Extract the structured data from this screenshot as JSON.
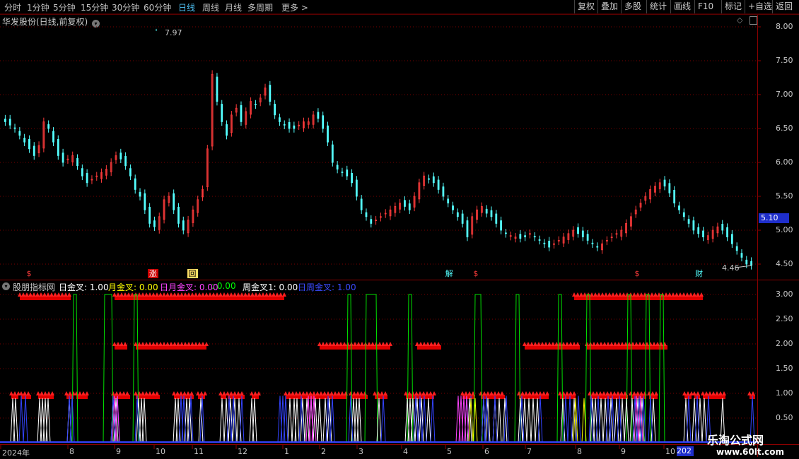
{
  "toolbar": {
    "periods": [
      {
        "label": "分时",
        "active": false
      },
      {
        "label": "1分钟",
        "active": false
      },
      {
        "label": "5分钟",
        "active": false
      },
      {
        "label": "15分钟",
        "active": false
      },
      {
        "label": "30分钟",
        "active": false
      },
      {
        "label": "60分钟",
        "active": false
      },
      {
        "label": "日线",
        "active": true
      },
      {
        "label": "周线",
        "active": false
      },
      {
        "label": "月线",
        "active": false
      },
      {
        "label": "多周期",
        "active": false
      },
      {
        "label": "更多 >",
        "active": false
      }
    ],
    "right": [
      "复权",
      "叠加",
      "多股",
      "统计",
      "画线",
      "F10",
      "标记",
      "+自选",
      "返回"
    ]
  },
  "stock": {
    "title": "华发股份(日线,前复权)"
  },
  "price_chart": {
    "type": "candlestick",
    "yticks": [
      "8.00",
      "7.50",
      "7.00",
      "6.50",
      "6.00",
      "5.50",
      "5.00",
      "4.50"
    ],
    "high_label": "7.97",
    "low_label": "4.46",
    "last_price": "5.10",
    "up_color": "#ff3b3b",
    "down_color": "#54ffff",
    "closes": [
      6.6,
      6.55,
      6.5,
      6.4,
      6.3,
      6.2,
      6.1,
      6.25,
      6.6,
      6.5,
      6.3,
      6.1,
      6.0,
      6.05,
      6.1,
      5.95,
      5.8,
      5.7,
      5.75,
      5.8,
      5.85,
      5.9,
      6.0,
      6.1,
      6.05,
      5.95,
      5.8,
      5.6,
      5.5,
      5.3,
      5.1,
      5.05,
      5.2,
      5.45,
      5.5,
      5.3,
      5.1,
      5.0,
      5.15,
      5.3,
      5.45,
      5.6,
      6.2,
      7.3,
      6.9,
      6.6,
      6.4,
      6.7,
      6.8,
      6.6,
      6.75,
      6.9,
      6.85,
      6.95,
      7.1,
      6.9,
      6.7,
      6.6,
      6.55,
      6.5,
      6.5,
      6.55,
      6.6,
      6.6,
      6.7,
      6.65,
      6.5,
      6.3,
      6.0,
      5.9,
      5.85,
      5.8,
      5.7,
      5.5,
      5.3,
      5.2,
      5.1,
      5.15,
      5.2,
      5.25,
      5.3,
      5.35,
      5.4,
      5.35,
      5.3,
      5.5,
      5.7,
      5.8,
      5.75,
      5.7,
      5.6,
      5.5,
      5.4,
      5.3,
      5.2,
      5.1,
      4.9,
      5.2,
      5.3,
      5.35,
      5.25,
      5.2,
      5.1,
      5.0,
      4.95,
      4.92,
      4.9,
      4.88,
      4.9,
      4.95,
      4.9,
      4.85,
      4.8,
      4.75,
      4.8,
      4.85,
      4.9,
      4.95,
      5.0,
      4.95,
      4.9,
      4.85,
      4.8,
      4.75,
      4.8,
      4.85,
      4.9,
      4.95,
      5.0,
      5.1,
      5.2,
      5.3,
      5.4,
      5.5,
      5.6,
      5.65,
      5.7,
      5.65,
      5.55,
      5.4,
      5.3,
      5.2,
      5.1,
      5.0,
      4.95,
      4.9,
      4.92,
      5.0,
      5.05,
      5.0,
      4.9,
      4.8,
      4.7,
      4.6,
      4.5,
      4.48
    ]
  },
  "markers": [
    {
      "text": "$",
      "color": "#ff3b3b",
      "bg": "",
      "x_frac": 0.035
    },
    {
      "text": "涨",
      "color": "#ffffff",
      "bg": "#cc0000",
      "x_frac": 0.195
    },
    {
      "text": "回",
      "color": "#000000",
      "bg": "#ffe066",
      "x_frac": 0.247
    },
    {
      "text": "解",
      "color": "#54ffff",
      "bg": "",
      "x_frac": 0.588
    },
    {
      "text": "$",
      "color": "#ff3b3b",
      "bg": "",
      "x_frac": 0.625
    },
    {
      "text": "$",
      "color": "#ff3b3b",
      "bg": "",
      "x_frac": 0.838
    },
    {
      "text": "财",
      "color": "#54ffff",
      "bg": "",
      "x_frac": 0.918
    }
  ],
  "indicator": {
    "name": "股朋指标网",
    "items": [
      {
        "label": "日金叉: 1.00",
        "color": "#ffffff"
      },
      {
        "label": "月金叉: 0.00",
        "color": "#ffff00"
      },
      {
        "label": "日月金叉: 0.00",
        "color": "#ff44ff"
      },
      {
        "label": ": 0.00",
        "color": "#00ff00"
      },
      {
        "label": "周金叉1: 0.00",
        "color": "#ffffff"
      },
      {
        "label": "日周金叉: 1.00",
        "color": "#3b4bff"
      }
    ],
    "yticks": [
      "3.00",
      "2.50",
      "2.00",
      "1.50",
      "1.00",
      "0.50"
    ]
  },
  "xaxis": {
    "labels": [
      "2024年",
      "8",
      "9",
      "10",
      "11",
      "12",
      "1",
      "2",
      "3",
      "4",
      "5",
      "6",
      "7",
      "8",
      "9",
      "10"
    ],
    "year_box": "202"
  },
  "watermark": {
    "line1": "乐淘公式网",
    "line2": "www.60lt.com"
  }
}
